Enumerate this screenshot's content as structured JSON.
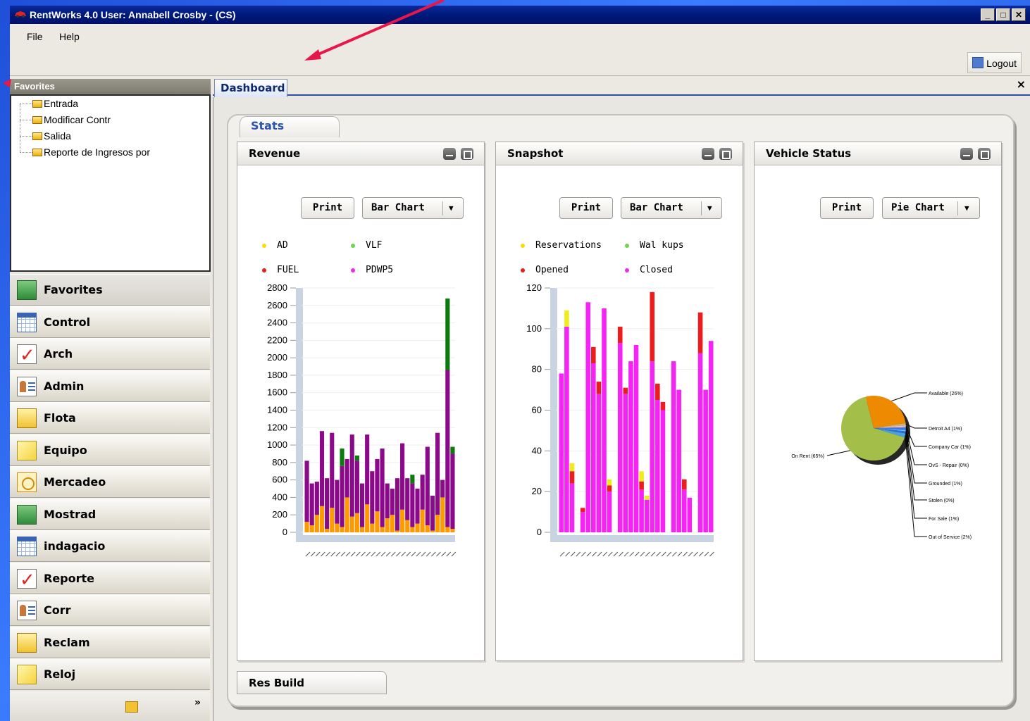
{
  "window": {
    "title": "RentWorks 4.0  User: Annabell Crosby - (CS)"
  },
  "menu": {
    "file": "File",
    "help": "Help"
  },
  "toolbar": {
    "logout": "Logout"
  },
  "favorites": {
    "header": "Favorites",
    "items": [
      "Entrada",
      "Modificar Contr",
      "Salida",
      "Reporte de Ingresos por"
    ]
  },
  "nav": {
    "items": [
      {
        "label": "Favorites",
        "icon": "favorites-icon"
      },
      {
        "label": "Control",
        "icon": "calendar-icon"
      },
      {
        "label": "Arch",
        "icon": "checklist-icon"
      },
      {
        "label": "Admin",
        "icon": "contact-card-icon"
      },
      {
        "label": "Flota",
        "icon": "folder-icon"
      },
      {
        "label": "Equipo",
        "icon": "note-icon"
      },
      {
        "label": "Mercadeo",
        "icon": "marketing-icon"
      },
      {
        "label": "Mostrad",
        "icon": "favorites-icon"
      },
      {
        "label": "indagacio",
        "icon": "calendar-icon"
      },
      {
        "label": "Reporte",
        "icon": "checklist-icon"
      },
      {
        "label": "Corr",
        "icon": "contact-card-icon"
      },
      {
        "label": "Reclam",
        "icon": "folder-icon"
      },
      {
        "label": "Reloj",
        "icon": "note-icon"
      }
    ],
    "footer_chevron": "»"
  },
  "dashboard": {
    "tab": "Dashboard",
    "close": "×",
    "stats_tab": "Stats",
    "res_build": "Res Build"
  },
  "panels": {
    "revenue": {
      "title": "Revenue",
      "print": "Print",
      "chart_type": "Bar Chart",
      "legend": [
        {
          "label": "AD",
          "color": "#f5e000"
        },
        {
          "label": "VLF",
          "color": "#6dd64a"
        },
        {
          "label": "FUEL",
          "color": "#e81c1c"
        },
        {
          "label": "PDWP5",
          "color": "#e92ce9"
        }
      ]
    },
    "snapshot": {
      "title": "Snapshot",
      "print": "Print",
      "chart_type": "Bar Chart",
      "legend": [
        {
          "label": "Reservations",
          "color": "#f5e000"
        },
        {
          "label": "Wal kups",
          "color": "#6dd64a"
        },
        {
          "label": "Opened",
          "color": "#e81c1c"
        },
        {
          "label": "Closed",
          "color": "#e92ce9"
        }
      ]
    },
    "vehicle_status": {
      "title": "Vehicle Status",
      "print": "Print",
      "chart_type": "Pie Chart"
    }
  },
  "chart_data": [
    {
      "type": "bar",
      "title": "Revenue",
      "ylim": [
        0,
        2800
      ],
      "yticks": [
        "2800",
        "2600",
        "2400",
        "2200",
        "2000",
        "1800",
        "1600",
        "1400",
        "1200",
        "1000",
        "800",
        "600",
        "400",
        "200",
        "0"
      ],
      "series": [
        {
          "name": "orange",
          "color": "#ff9900",
          "values": [
            120,
            80,
            200,
            300,
            40,
            280,
            100,
            60,
            400,
            180,
            220,
            60,
            320,
            100,
            240,
            60,
            160,
            200,
            20,
            260,
            140,
            60,
            100,
            260,
            80,
            20,
            200,
            400,
            60,
            40
          ]
        },
        {
          "name": "purple",
          "color": "#8a0a8a",
          "values": [
            700,
            480,
            380,
            860,
            580,
            860,
            500,
            700,
            440,
            940,
            600,
            500,
            800,
            600,
            600,
            900,
            400,
            300,
            600,
            760,
            480,
            500,
            400,
            400,
            900,
            400,
            940,
            200,
            1800,
            860
          ]
        },
        {
          "name": "green",
          "color": "#0d7a0d",
          "values": [
            0,
            0,
            0,
            0,
            0,
            0,
            0,
            200,
            0,
            0,
            60,
            0,
            0,
            0,
            0,
            0,
            0,
            0,
            0,
            0,
            0,
            100,
            0,
            0,
            0,
            0,
            0,
            0,
            820,
            80
          ]
        }
      ]
    },
    {
      "type": "bar",
      "title": "Snapshot",
      "ylim": [
        0,
        120
      ],
      "yticks": [
        "120",
        "100",
        "80",
        "60",
        "40",
        "20",
        "0"
      ],
      "series": [
        {
          "name": "Closed",
          "color": "#f524f5",
          "values": [
            78,
            101,
            24,
            0,
            10,
            113,
            83,
            68,
            110,
            20,
            0,
            93,
            68,
            84,
            92,
            21,
            16,
            84,
            65,
            60,
            0,
            84,
            70,
            21,
            17,
            0,
            88,
            70,
            94
          ]
        },
        {
          "name": "Opened",
          "color": "#ee1c1c",
          "values": [
            0,
            0,
            6,
            0,
            2,
            0,
            8,
            6,
            0,
            3,
            0,
            8,
            3,
            0,
            0,
            4,
            0,
            34,
            8,
            4,
            0,
            0,
            0,
            5,
            0,
            0,
            20,
            0,
            0
          ]
        },
        {
          "name": "Reservations",
          "color": "#f0ec1c",
          "values": [
            0,
            8,
            4,
            0,
            0,
            0,
            0,
            0,
            0,
            3,
            0,
            0,
            0,
            0,
            0,
            5,
            2,
            0,
            0,
            0,
            0,
            0,
            0,
            0,
            0,
            0,
            0,
            0,
            0
          ]
        }
      ]
    },
    {
      "type": "pie",
      "title": "Vehicle Status",
      "slices": [
        {
          "label": "Available (26%)",
          "value": 26,
          "color": "#ee8a00"
        },
        {
          "label": "Detroit A4 (1%)",
          "value": 1,
          "color": "#d8b060"
        },
        {
          "label": "Company Car (1%)",
          "value": 1,
          "color": "#c9c9c9"
        },
        {
          "label": "OvS - Repair (0%)",
          "value": 0.5,
          "color": "#9966cc"
        },
        {
          "label": "Grounded (1%)",
          "value": 1,
          "color": "#3b82f6"
        },
        {
          "label": "Stolen (0%)",
          "value": 0.5,
          "color": "#66ccff"
        },
        {
          "label": "For Sale (1%)",
          "value": 1,
          "color": "#2b6bd6"
        },
        {
          "label": "Out of Service (2%)",
          "value": 2,
          "color": "#4aa0e0"
        },
        {
          "label": "On Rent (65%)",
          "value": 65,
          "color": "#a3bf4a"
        }
      ]
    }
  ]
}
